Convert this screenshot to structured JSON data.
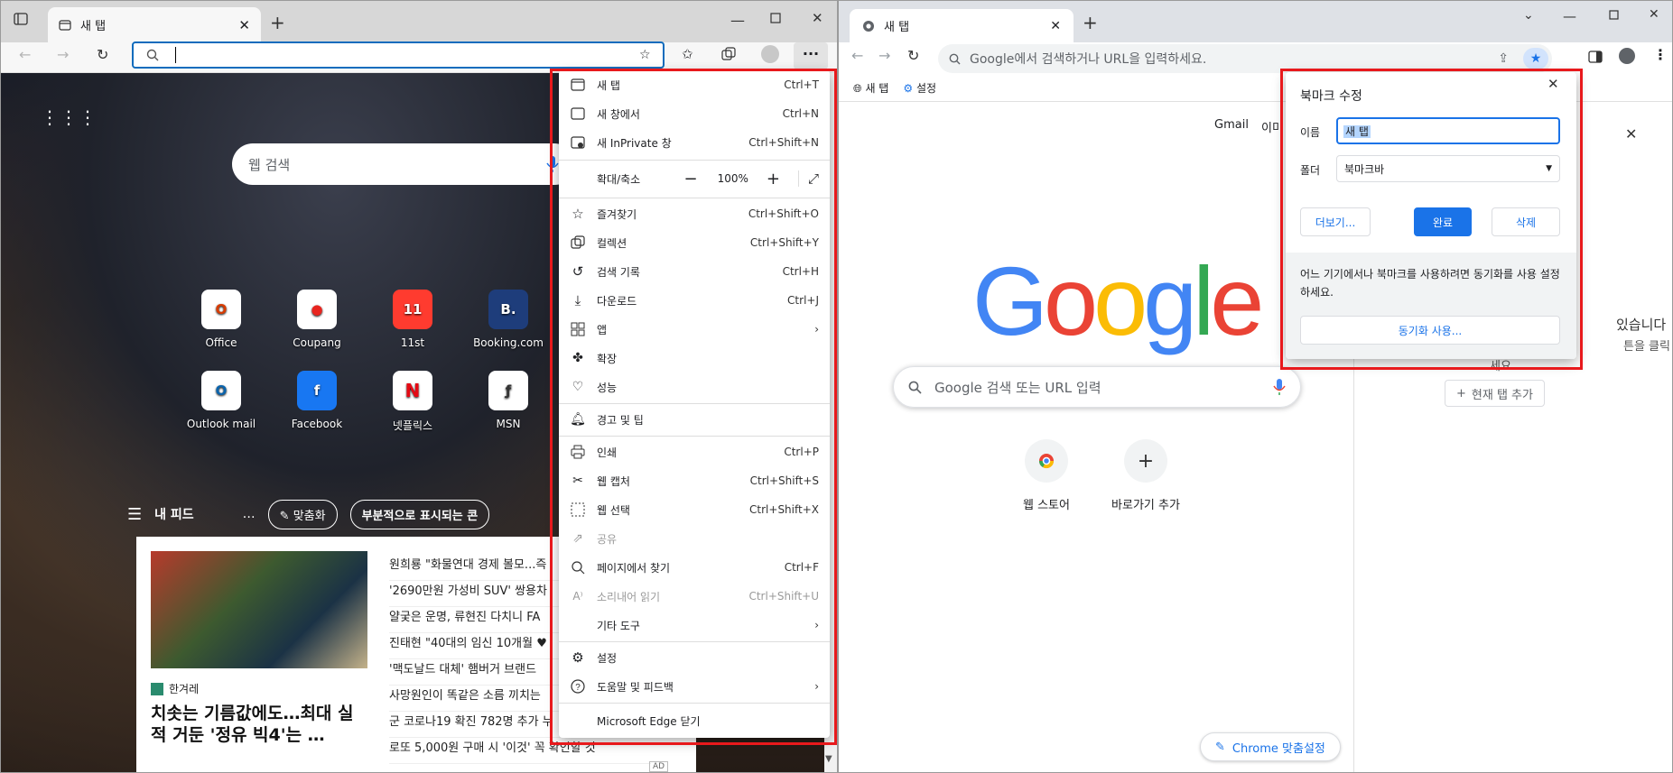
{
  "edge": {
    "tab_title": "새 탭",
    "search_placeholder": "웹 검색",
    "tiles": [
      {
        "label": "Office",
        "glyph": "O",
        "color": "#d83b01"
      },
      {
        "label": "Coupang",
        "glyph": "●",
        "color": "#e8251f"
      },
      {
        "label": "11st",
        "glyph": "11",
        "color": "#ff3b2f"
      },
      {
        "label": "Booking.com",
        "glyph": "B.",
        "color": "#1e3d7b"
      },
      {
        "label": "Outlook mail",
        "glyph": "O",
        "color": "#0a64ad"
      },
      {
        "label": "Facebook",
        "glyph": "f",
        "color": "#1877f2"
      },
      {
        "label": "넷플릭스",
        "glyph": "N",
        "color": "#e50914"
      },
      {
        "label": "MSN",
        "glyph": "ƒ",
        "color": "#333333"
      }
    ],
    "feed": {
      "title": "내 피드",
      "more": "…",
      "chip1": "맞춤화",
      "chip2": "부분적으로 표시되는 콘"
    },
    "news_source": "한겨레",
    "news_headline": "치솟는 기름값에도…최대 실적 거둔 '정유 빅4'는 …",
    "news_items": [
      "원희룡 \"화물연대 경제 볼모...즉",
      "'2690만원 가성비 SUV' 쌍용차",
      "얄궂은 운명, 류현진 다치니 FA",
      "진태현 \"40대의 임신 10개월 ♥",
      "'맥도날드 대체' 햄버거 브랜드",
      "사망원인이 똑같은 소름 끼치는",
      "군 코로나19 확진 782명 추가 누",
      "로또 5,000원 구매 시 '이것' 꼭 확인할 것"
    ],
    "ad_badge": "AD",
    "menu": {
      "new_tab": {
        "label": "새 탭",
        "sc": "Ctrl+T"
      },
      "new_window": {
        "label": "새 창에서",
        "sc": "Ctrl+N"
      },
      "inprivate": {
        "label": "새 InPrivate 창",
        "sc": "Ctrl+Shift+N"
      },
      "zoom": {
        "label": "확대/축소",
        "value": "100%"
      },
      "favorites": {
        "label": "즐겨찾기",
        "sc": "Ctrl+Shift+O"
      },
      "collections": {
        "label": "컬렉션",
        "sc": "Ctrl+Shift+Y"
      },
      "history": {
        "label": "검색 기록",
        "sc": "Ctrl+H"
      },
      "downloads": {
        "label": "다운로드",
        "sc": "Ctrl+J"
      },
      "apps": {
        "label": "앱"
      },
      "extensions": {
        "label": "확장"
      },
      "performance": {
        "label": "성능"
      },
      "alerts": {
        "label": "경고 및 팁"
      },
      "print": {
        "label": "인쇄",
        "sc": "Ctrl+P"
      },
      "webcapture": {
        "label": "웹 캡처",
        "sc": "Ctrl+Shift+S"
      },
      "webselect": {
        "label": "웹 선택",
        "sc": "Ctrl+Shift+X"
      },
      "share": {
        "label": "공유"
      },
      "find": {
        "label": "페이지에서 찾기",
        "sc": "Ctrl+F"
      },
      "readaloud": {
        "label": "소리내어 읽기",
        "sc": "Ctrl+Shift+U"
      },
      "moretools": {
        "label": "기타 도구"
      },
      "settings": {
        "label": "설정"
      },
      "help": {
        "label": "도움말 및 피드백"
      },
      "close": {
        "label": "Microsoft Edge 닫기"
      }
    }
  },
  "chrome": {
    "tab_title": "새 탭",
    "omnibox_placeholder": "Google에서 검색하거나 URL을 입력하세요.",
    "bookmarks": [
      "새 탭",
      "설정"
    ],
    "top_links": [
      "Gmail",
      "이미"
    ],
    "search_placeholder": "Google 검색 또는 URL 입력",
    "shortcuts": [
      {
        "label": "웹 스토어"
      },
      {
        "label": "바로가기 추가"
      }
    ],
    "customize": "Chrome 맞춤설정",
    "side_text1": "있습니다",
    "side_text2": "튼을 클릭",
    "side_text3": "세요",
    "side_add": "현재 탭 추가",
    "dialog": {
      "title": "북마크 수정",
      "name_label": "이름",
      "name_value": "새 탭",
      "folder_label": "폴더",
      "folder_value": "북마크바",
      "more": "더보기...",
      "done": "완료",
      "delete": "삭제",
      "sync_text": "어느 기기에서나 북마크를 사용하려면 동기화를 사용 설정하세요.",
      "sync_button": "동기화 사용..."
    }
  },
  "colors": {
    "highlight_red": "#e8191c",
    "chrome_blue": "#1a73e8",
    "edge_blue": "#0f6cbd"
  }
}
